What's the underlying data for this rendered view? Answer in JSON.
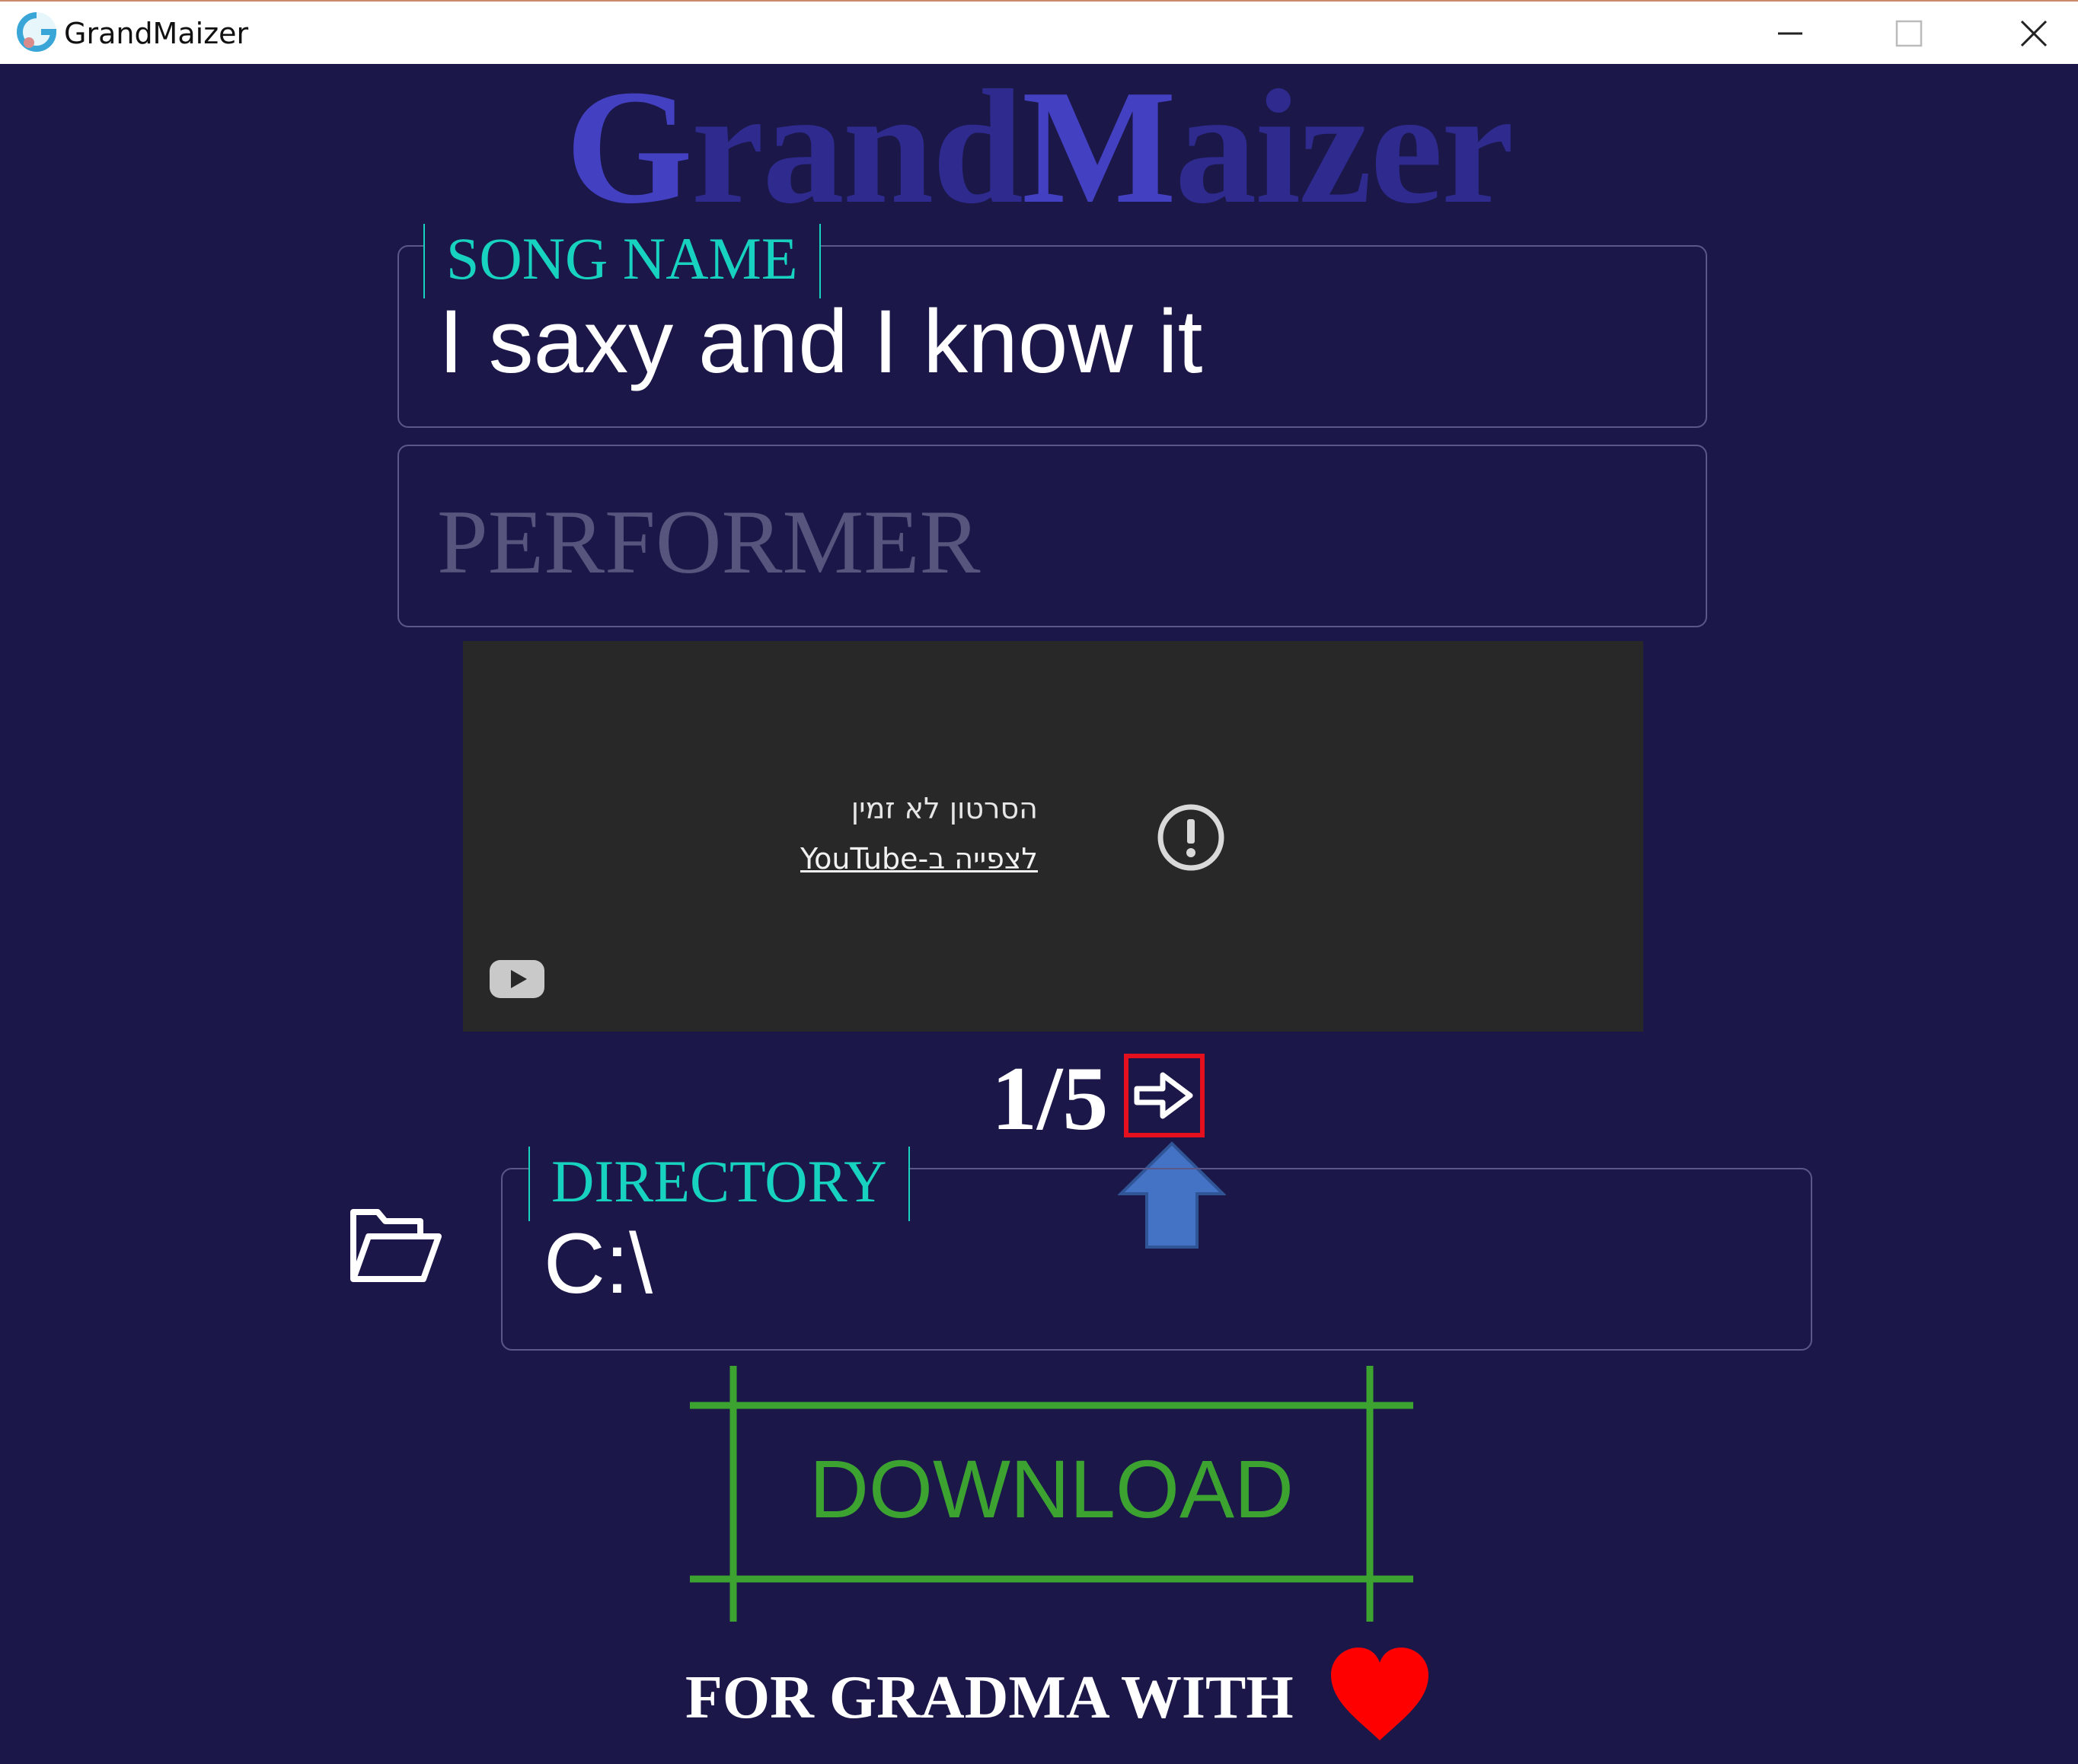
{
  "window": {
    "title": "GrandMaizer",
    "controls": {
      "minimize": "minimize-icon",
      "maximize": "maximize-icon",
      "close": "close-icon"
    }
  },
  "heading": {
    "first_cap": "G",
    "first_rest": "rand",
    "second_cap": "M",
    "second_rest": "aizer"
  },
  "song": {
    "legend": "SONG NAME",
    "value": "I saxy and I know it"
  },
  "performer": {
    "placeholder": "PERFORMER",
    "value": ""
  },
  "video": {
    "message": "הסרטון לא זמין",
    "link": "לצפייה ב-YouTube",
    "icons": {
      "alert": "alert-circle-icon",
      "logo": "youtube-icon"
    }
  },
  "pager": {
    "text": "1/5",
    "current": 1,
    "total": 5,
    "next_icon": "arrow-right-icon"
  },
  "hint": {
    "icon": "up-arrow-icon",
    "color": "#4472c4"
  },
  "directory": {
    "legend": "DIRECTORY",
    "value": "C:\\",
    "folder_icon": "folder-open-icon"
  },
  "download": {
    "label": "DOWNLOAD",
    "color": "#3ca331"
  },
  "footer": {
    "text": "FOR GRADMA WITH",
    "icon": "heart-icon",
    "heart_color": "#ff0000"
  },
  "colors": {
    "background": "#1b1849",
    "legend": "#18d2c0",
    "heading_dark": "#2e2a8e",
    "heading_light": "#4340c2",
    "highlight": "#e5101e"
  }
}
